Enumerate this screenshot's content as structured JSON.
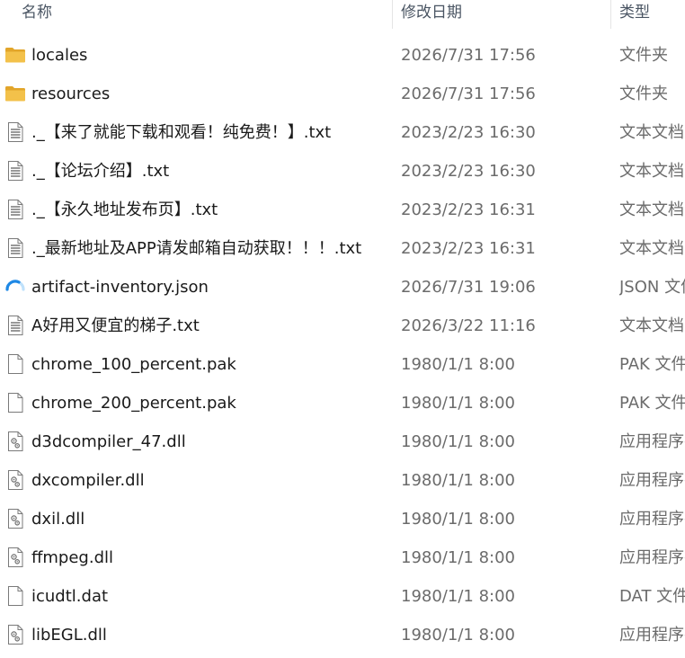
{
  "columns": {
    "name": "名称",
    "date": "修改日期",
    "type": "类型"
  },
  "files": [
    {
      "name": "locales",
      "date": "2026/7/31 17:56",
      "type": "文件夹",
      "icon": "folder-icon"
    },
    {
      "name": "resources",
      "date": "2026/7/31 17:56",
      "type": "文件夹",
      "icon": "folder-icon"
    },
    {
      "name": "._【来了就能下载和观看！纯免费！】.txt",
      "date": "2023/2/23 16:30",
      "type": "文本文档",
      "icon": "text-file-icon"
    },
    {
      "name": "._【论坛介绍】.txt",
      "date": "2023/2/23 16:30",
      "type": "文本文档",
      "icon": "text-file-icon"
    },
    {
      "name": "._【永久地址发布页】.txt",
      "date": "2023/2/23 16:31",
      "type": "文本文档",
      "icon": "text-file-icon"
    },
    {
      "name": "._最新地址及APP请发邮箱自动获取！！！.txt",
      "date": "2023/2/23 16:31",
      "type": "文本文档",
      "icon": "text-file-icon"
    },
    {
      "name": "artifact-inventory.json",
      "date": "2026/7/31 19:06",
      "type": "JSON 文件",
      "icon": "json-file-icon"
    },
    {
      "name": "A好用又便宜的梯子.txt",
      "date": "2026/3/22 11:16",
      "type": "文本文档",
      "icon": "text-file-icon"
    },
    {
      "name": "chrome_100_percent.pak",
      "date": "1980/1/1 8:00",
      "type": "PAK 文件",
      "icon": "blank-file-icon"
    },
    {
      "name": "chrome_200_percent.pak",
      "date": "1980/1/1 8:00",
      "type": "PAK 文件",
      "icon": "blank-file-icon"
    },
    {
      "name": "d3dcompiler_47.dll",
      "date": "1980/1/1 8:00",
      "type": "应用程序扩展",
      "icon": "dll-file-icon"
    },
    {
      "name": "dxcompiler.dll",
      "date": "1980/1/1 8:00",
      "type": "应用程序扩展",
      "icon": "dll-file-icon"
    },
    {
      "name": "dxil.dll",
      "date": "1980/1/1 8:00",
      "type": "应用程序扩展",
      "icon": "dll-file-icon"
    },
    {
      "name": "ffmpeg.dll",
      "date": "1980/1/1 8:00",
      "type": "应用程序扩展",
      "icon": "dll-file-icon"
    },
    {
      "name": "icudtl.dat",
      "date": "1980/1/1 8:00",
      "type": "DAT 文件",
      "icon": "blank-file-icon"
    },
    {
      "name": "libEGL.dll",
      "date": "1980/1/1 8:00",
      "type": "应用程序扩展",
      "icon": "dll-file-icon"
    }
  ],
  "colors": {
    "folder": "#f3c14a",
    "folder_dark": "#e2a52a",
    "json_accent": "#1e88e5"
  }
}
